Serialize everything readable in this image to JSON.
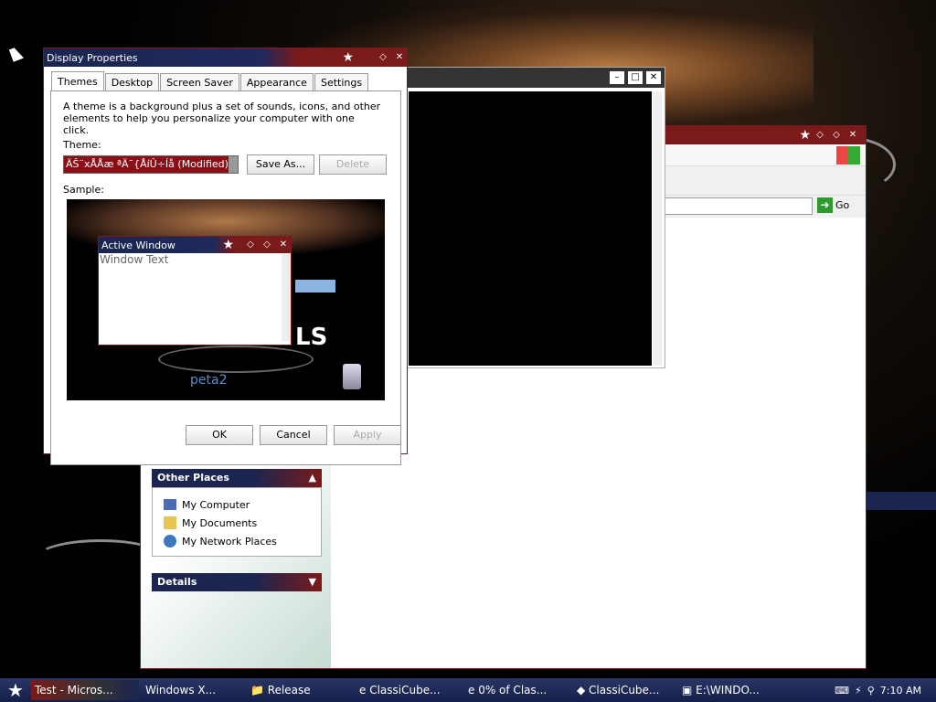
{
  "display_properties": {
    "title": "Display Properties",
    "tabs": [
      "Themes",
      "Desktop",
      "Screen Saver",
      "Appearance",
      "Settings"
    ],
    "description": "A theme is a background plus a set of sounds, icons, and other elements to help you personalize your computer with one click.",
    "theme_label": "Theme:",
    "theme_value": "ÄŠ¨xÅÅæ ªÄ¯{ÅíÛ÷Íå (Modified)",
    "save_as": "Save As...",
    "delete": "Delete",
    "sample_label": "Sample:",
    "preview": {
      "active_window": "Active Window",
      "window_text": "Window Text",
      "logo_text": "LS",
      "brand": "peta2"
    },
    "ok": "OK",
    "cancel": "Cancel",
    "apply": "Apply"
  },
  "explorer": {
    "go": "Go",
    "other_places": "Other Places",
    "places": [
      "My Computer",
      "My Documents",
      "My Network Places"
    ],
    "details": "Details"
  },
  "taskbar": {
    "tasks": [
      "Test - Micros...",
      "Windows X...",
      "Release",
      "ClassiCube...",
      "0% of Clas...",
      "ClassiCube...",
      "E:\\WINDO..."
    ],
    "clock": "7:10 AM"
  }
}
